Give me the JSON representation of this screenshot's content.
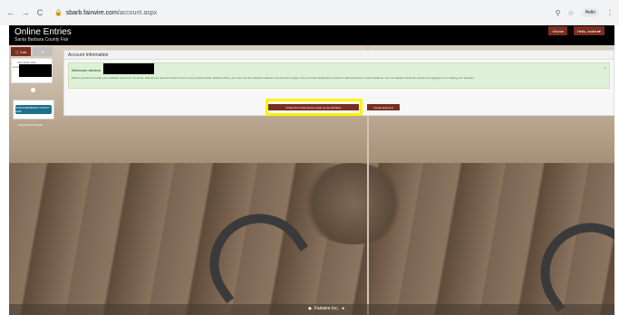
{
  "browser": {
    "back": "←",
    "forward": "→",
    "reload": "C",
    "url_host": "sbarb.fairwire.com",
    "url_path": "/account.aspx",
    "zoom_icon": "⚲",
    "star_icon": "☆",
    "profile": "Hello",
    "menu_icon": "⋮"
  },
  "header": {
    "title": "Online Entries",
    "subtitle": "Santa Barbara County Fair",
    "home_label": "Home",
    "user_label": "Hello, andrea"
  },
  "left_panel": {
    "cart_label": "Cart",
    "edit_label": "",
    "card_label": "Your Entry Cart",
    "card_small": "entries\n0 total",
    "logo_text": "SANTA BARBARA COUNTY FAIR",
    "powered_by": "Powered by Fairwire"
  },
  "account": {
    "header": "Account Information",
    "welcome": "Welcome andrea",
    "body": "Please proceed to create your exhibitor account or continue. Should you need to correct errors on any sections while adding entries, you may use the progress indicator near the top of page once you have started the process to click and jump to other locations. You can always cancel the process by logging out or closing your browser.",
    "close": "×",
    "show_button": "View Print Instructions made by the Exhibitor",
    "create_button": "Create Entries"
  },
  "colors": {
    "brand_maroon": "#7a2e20",
    "highlight": "#fff200",
    "alert_bg": "#dff0d8"
  },
  "footer": {
    "icon_a": "◆",
    "text": "Fairwire Inc.",
    "icon_b": "●"
  }
}
